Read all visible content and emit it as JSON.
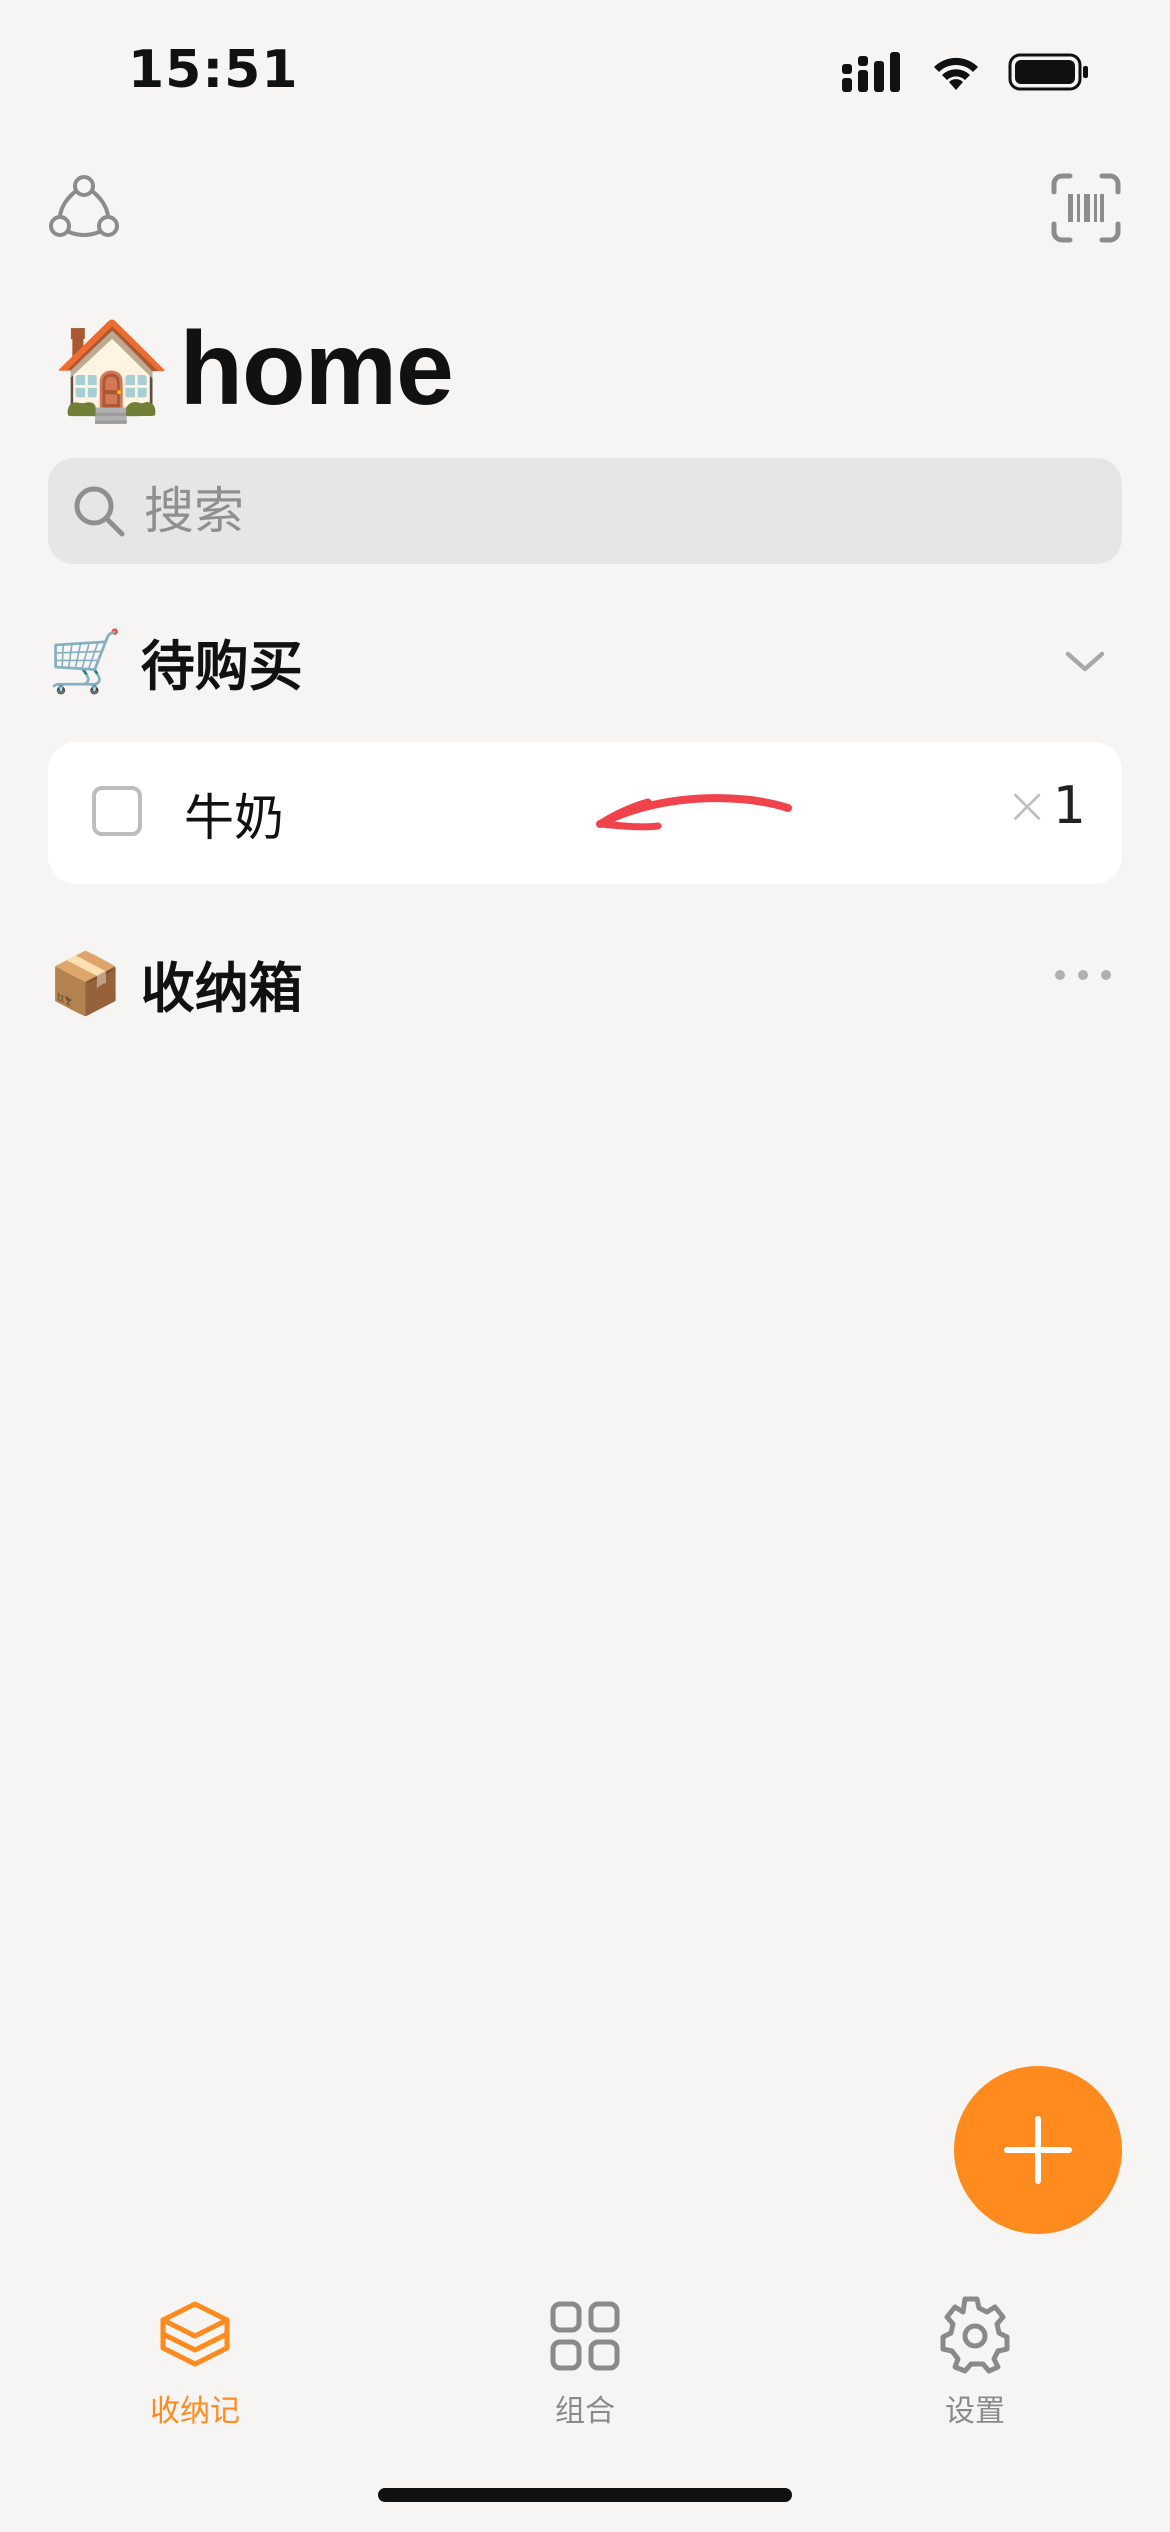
{
  "status_bar": {
    "time": "15:51"
  },
  "header": {
    "title_emoji": "🏠",
    "title": "home",
    "left_icon": "share-network-icon",
    "right_icon": "barcode-scan-icon"
  },
  "search": {
    "placeholder": "搜索"
  },
  "sections": [
    {
      "emoji": "🛒",
      "title": "待购买",
      "action_icon": "chevron-down-icon",
      "items": [
        {
          "name": "牛奶",
          "qty_prefix": "×",
          "qty": "1",
          "checked": false
        }
      ]
    },
    {
      "emoji": "📦",
      "title": "收纳箱",
      "action_icon": "more-horizontal-icon",
      "items": []
    }
  ],
  "fab": {
    "icon": "plus-icon"
  },
  "tab_bar": {
    "tabs": [
      {
        "label": "收纳记",
        "icon": "layers-icon",
        "active": true
      },
      {
        "label": "组合",
        "icon": "grid-icon",
        "active": false
      },
      {
        "label": "设置",
        "icon": "gear-icon",
        "active": false
      }
    ]
  },
  "colors": {
    "accent": "#ff8b1f",
    "background": "#f6f5f3",
    "search_bg": "#e7e6e4",
    "annotation_arrow": "#f0434b"
  }
}
